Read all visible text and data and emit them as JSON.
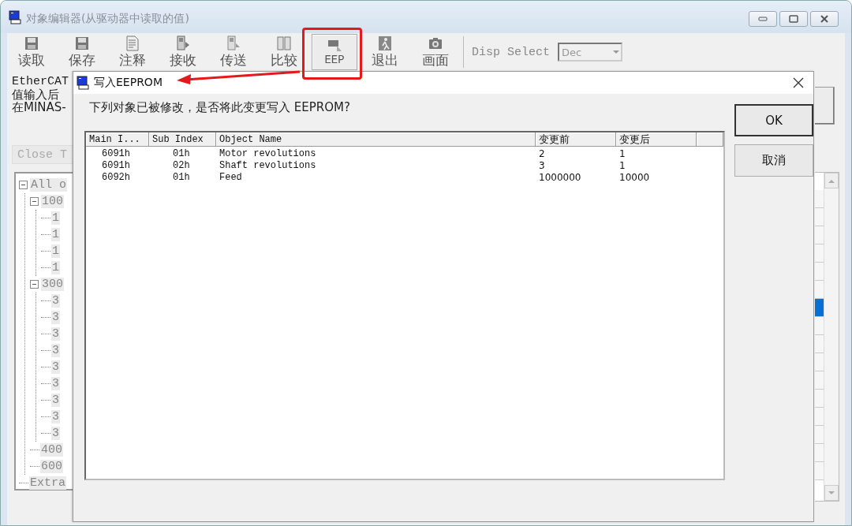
{
  "window": {
    "title": "对象编辑器(从驱动器中读取的值)"
  },
  "toolbar": {
    "buttons": [
      {
        "label": "读取",
        "pressed": false
      },
      {
        "label": "保存",
        "pressed": false
      },
      {
        "label": "注释",
        "pressed": false
      },
      {
        "label": "接收",
        "pressed": false
      },
      {
        "label": "传送",
        "pressed": false
      },
      {
        "label": "比较",
        "pressed": false
      },
      {
        "label": "EEP",
        "pressed": true
      },
      {
        "label": "退出",
        "pressed": false
      },
      {
        "label": "画面",
        "pressed": false
      }
    ],
    "disp_select": {
      "label": "Disp Select",
      "value": "Dec"
    }
  },
  "info_lines": [
    "EtherCAT",
    "值输入后",
    "在MINAS-"
  ],
  "close_tree_button": {
    "label": "Close T",
    "disabled": true
  },
  "tree": [
    {
      "label": "All o",
      "expanded": true,
      "children": [
        {
          "label": "100",
          "expanded": true,
          "children": [
            {
              "label": "1"
            },
            {
              "label": "1"
            },
            {
              "label": "1"
            },
            {
              "label": "1"
            }
          ]
        },
        {
          "label": "300",
          "expanded": true,
          "children": [
            {
              "label": "3"
            },
            {
              "label": "3"
            },
            {
              "label": "3"
            },
            {
              "label": "3"
            },
            {
              "label": "3"
            },
            {
              "label": "3"
            },
            {
              "label": "3"
            },
            {
              "label": "3"
            },
            {
              "label": "3"
            }
          ]
        },
        {
          "label": "400"
        },
        {
          "label": "600"
        }
      ]
    },
    {
      "label": "Extra"
    }
  ],
  "right_table": {
    "rows": [
      {
        "selected": false
      },
      {
        "selected": false
      },
      {
        "selected": false
      },
      {
        "selected": false
      },
      {
        "selected": false
      },
      {
        "selected": false
      },
      {
        "selected": true
      },
      {
        "selected": false
      },
      {
        "selected": false
      },
      {
        "selected": false
      },
      {
        "selected": false
      },
      {
        "selected": false
      },
      {
        "selected": false
      },
      {
        "selected": false
      },
      {
        "selected": false
      },
      {
        "selected": false
      }
    ]
  },
  "dialog": {
    "title": "写入EEPROM",
    "message": "下列对象已被修改，是否将此变更写入 EEPROM?",
    "columns": [
      "Main I...",
      "Sub Index",
      "Object Name",
      "变更前",
      "变更后"
    ],
    "rows": [
      [
        "6091h",
        "01h",
        "Motor revolutions",
        "2",
        "1"
      ],
      [
        "6091h",
        "02h",
        "Shaft revolutions",
        "3",
        "1"
      ],
      [
        "6092h",
        "01h",
        "Feed",
        "1000000",
        "10000"
      ]
    ],
    "buttons": [
      {
        "label": "OK",
        "default": true
      },
      {
        "label": "取消",
        "default": false
      }
    ]
  }
}
